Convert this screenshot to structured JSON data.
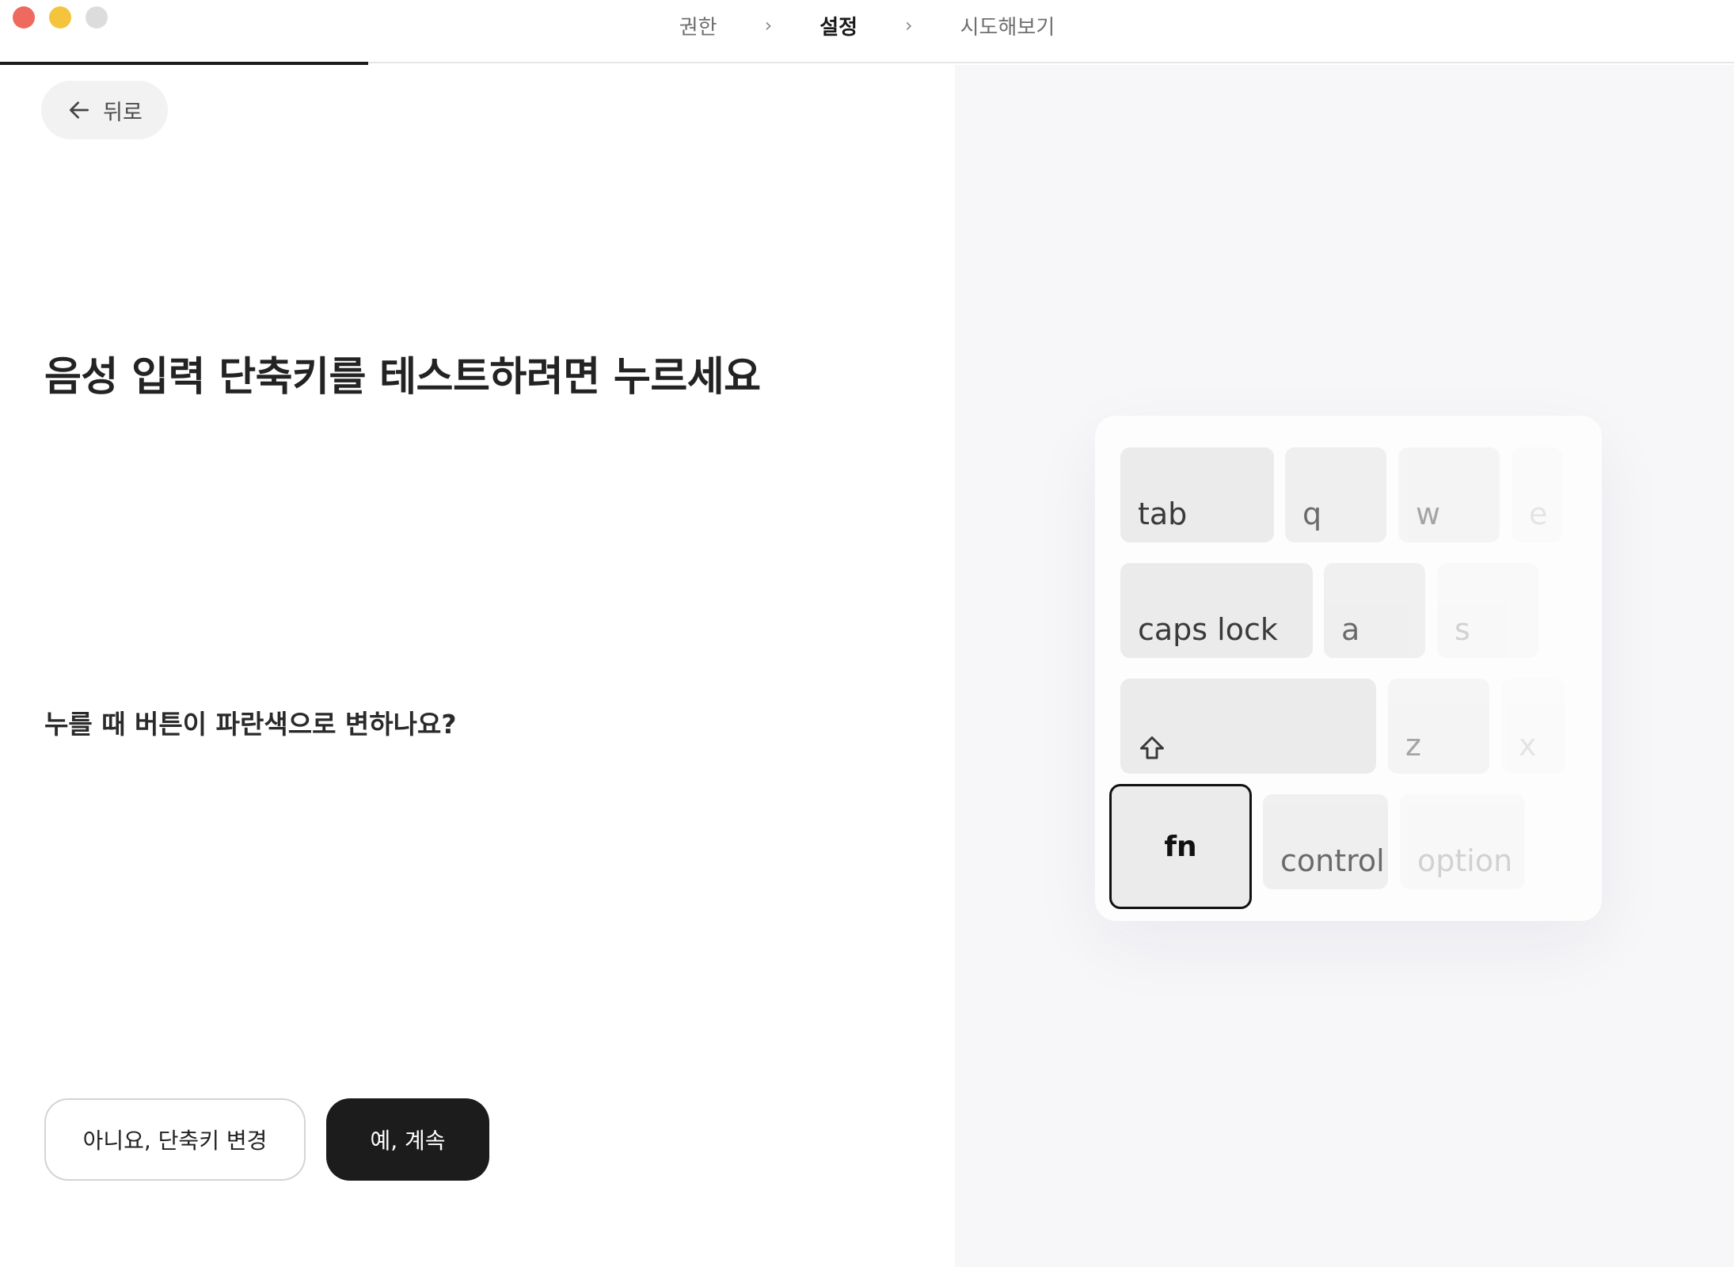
{
  "window": {
    "controls": [
      "close",
      "minimize",
      "maximize"
    ]
  },
  "steps": {
    "items": [
      {
        "label": "권한",
        "active": false
      },
      {
        "label": "설정",
        "active": true
      },
      {
        "label": "시도해보기",
        "active": false
      }
    ],
    "separator": "›",
    "progress": 0.3
  },
  "back": {
    "label": "뒤로",
    "icon": "arrow-left-icon"
  },
  "main": {
    "headline": "음성 입력 단축키를 테스트하려면 누르세요",
    "question": "누를 때 버튼이 파란색으로 변하나요?"
  },
  "actions": {
    "no_label": "아니요, 단축키 변경",
    "yes_label": "예, 계속"
  },
  "keyboard": {
    "row1": [
      "tab",
      "q",
      "w",
      "e"
    ],
    "row2": [
      "caps lock",
      "a",
      "s"
    ],
    "row3": [
      "z",
      "x"
    ],
    "shift_icon": "shift-icon",
    "row4": [
      "fn",
      "control",
      "option"
    ],
    "highlighted_key": "fn"
  },
  "colors": {
    "close": "#ee6a5f",
    "minimize": "#f5c43d",
    "maximize": "#dcdcdc",
    "primary_button": "#1c1c1c",
    "right_panel_bg": "#f7f7f9"
  }
}
